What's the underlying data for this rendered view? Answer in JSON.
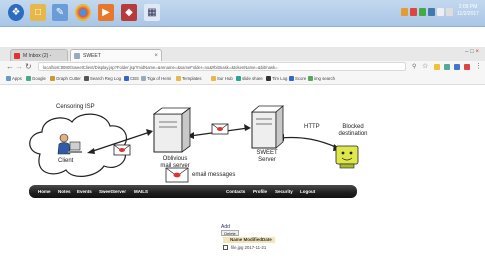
{
  "taskbar": {
    "icons": [
      "windows-orb-icon",
      "folder-icon",
      "paint-icon",
      "chrome-icon",
      "media-icon",
      "security-shield-icon",
      "calendar-icon"
    ],
    "clock_time": "2:09 PM",
    "clock_date": "11/2/2017"
  },
  "browser": {
    "tabs": [
      {
        "label": "M Inbox (2) - clouds... x"
      },
      {
        "label": "SWEET"
      }
    ],
    "url": "localhost:8080/SweetClient/Display.jsp?Folder.jsp?midName=&rename=&sameFolder=no&#bitmask=&tokenName=&bitmask=",
    "bookmarks": [
      "Apps",
      "Google",
      "Graph Cutter",
      "Search Reg Log",
      "CBS",
      "Tiga of Hemi",
      "Templates",
      "Sur Hub",
      "slide share",
      "Tim Log",
      "Score",
      "img search"
    ]
  },
  "diagram": {
    "censoring_isp": "Censoring ISP",
    "client": "Client",
    "oblivious_server": "Oblivious mail server",
    "sweet_server": "SWEET Server",
    "http": "HTTP",
    "blocked_destination": "Blocked destination",
    "email_messages": "email messages"
  },
  "menu": {
    "left": [
      "Home",
      "Notes",
      "Events",
      "SweetServer",
      "MAILS"
    ],
    "right": [
      "Contacts",
      "Profile",
      "Security",
      "Logout"
    ]
  },
  "content": {
    "add_link": "Add",
    "delete_label": "Delete",
    "table_header": "Name ModifiedDate",
    "row_text": "file.jpg 2017-11-21"
  }
}
